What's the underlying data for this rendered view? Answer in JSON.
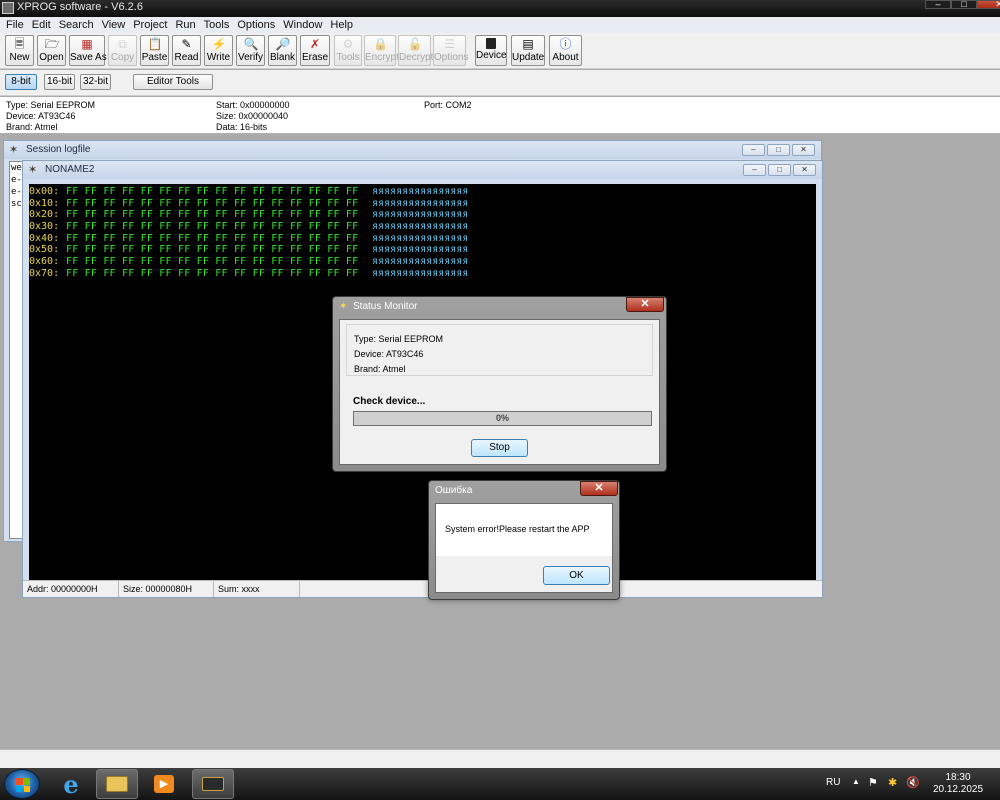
{
  "window": {
    "title": "XPROG software - V6.2.6"
  },
  "menu": [
    "File",
    "Edit",
    "Search",
    "View",
    "Project",
    "Run",
    "Tools",
    "Options",
    "Window",
    "Help"
  ],
  "toolbar": {
    "new": "New",
    "open": "Open",
    "save_as": "Save As",
    "copy": "Copy",
    "paste": "Paste",
    "read": "Read",
    "write": "Write",
    "verify": "Verify",
    "blank": "Blank",
    "erase": "Erase",
    "tools": "Tools",
    "encrypt": "Encrypt",
    "decrypt": "Decrypt",
    "options": "Options",
    "device": "Device",
    "update": "Update",
    "about": "About"
  },
  "modes": {
    "bit8": "8-bit",
    "bit16": "16-bit",
    "bit32": "32-bit",
    "editor_tools": "Editor Tools",
    "selected": "8-bit"
  },
  "info": {
    "type": "Type: Serial EEPROM",
    "device": "Device: AT93C46",
    "brand": "Brand: Atmel",
    "start": "Start: 0x00000000",
    "size": "Size: 0x00000040",
    "data": "Data: 16-bits",
    "port": "Port: COM2"
  },
  "session_log": {
    "title": "Session logfile",
    "lines": [
      "we",
      "e-",
      "e-",
      "sc"
    ]
  },
  "editor": {
    "title": "NONAME2",
    "rows": [
      {
        "addr": "0x00:",
        "bytes": "FF FF FF FF FF FF FF FF FF FF FF FF FF FF FF FF",
        "ascii": "яяяяяяяяяяяяяяяя"
      },
      {
        "addr": "0x10:",
        "bytes": "FF FF FF FF FF FF FF FF FF FF FF FF FF FF FF FF",
        "ascii": "яяяяяяяяяяяяяяяя"
      },
      {
        "addr": "0x20:",
        "bytes": "FF FF FF FF FF FF FF FF FF FF FF FF FF FF FF FF",
        "ascii": "яяяяяяяяяяяяяяяя"
      },
      {
        "addr": "0x30:",
        "bytes": "FF FF FF FF FF FF FF FF FF FF FF FF FF FF FF FF",
        "ascii": "яяяяяяяяяяяяяяяя"
      },
      {
        "addr": "0x40:",
        "bytes": "FF FF FF FF FF FF FF FF FF FF FF FF FF FF FF FF",
        "ascii": "яяяяяяяяяяяяяяяя"
      },
      {
        "addr": "0x50:",
        "bytes": "FF FF FF FF FF FF FF FF FF FF FF FF FF FF FF FF",
        "ascii": "яяяяяяяяяяяяяяяя"
      },
      {
        "addr": "0x60:",
        "bytes": "FF FF FF FF FF FF FF FF FF FF FF FF FF FF FF FF",
        "ascii": "яяяяяяяяяяяяяяяя"
      },
      {
        "addr": "0x70:",
        "bytes": "FF FF FF FF FF FF FF FF FF FF FF FF FF FF FF FF",
        "ascii": "яяяяяяяяяяяяяяяя"
      }
    ],
    "status": {
      "addr": "Addr: 00000000H",
      "size": "Size: 00000080H",
      "sum": "Sum: xxxx"
    }
  },
  "status_monitor": {
    "title": "Status Monitor",
    "type": "Type: Serial EEPROM",
    "device": "Device: AT93C46",
    "brand": "Brand: Atmel",
    "action": "Check device...",
    "progress": 0,
    "progress_label": "0%",
    "stop": "Stop"
  },
  "error_dialog": {
    "title": "Ошибка",
    "message": "System error!Please restart the APP",
    "ok": "OK"
  },
  "taskbar": {
    "lang": "RU",
    "time": "18:30",
    "date": "20.12.2025"
  },
  "colors": {
    "hex_addr": "#e8d24a",
    "hex_bytes": "#37e02b",
    "hex_ascii": "#5fc3e8"
  }
}
